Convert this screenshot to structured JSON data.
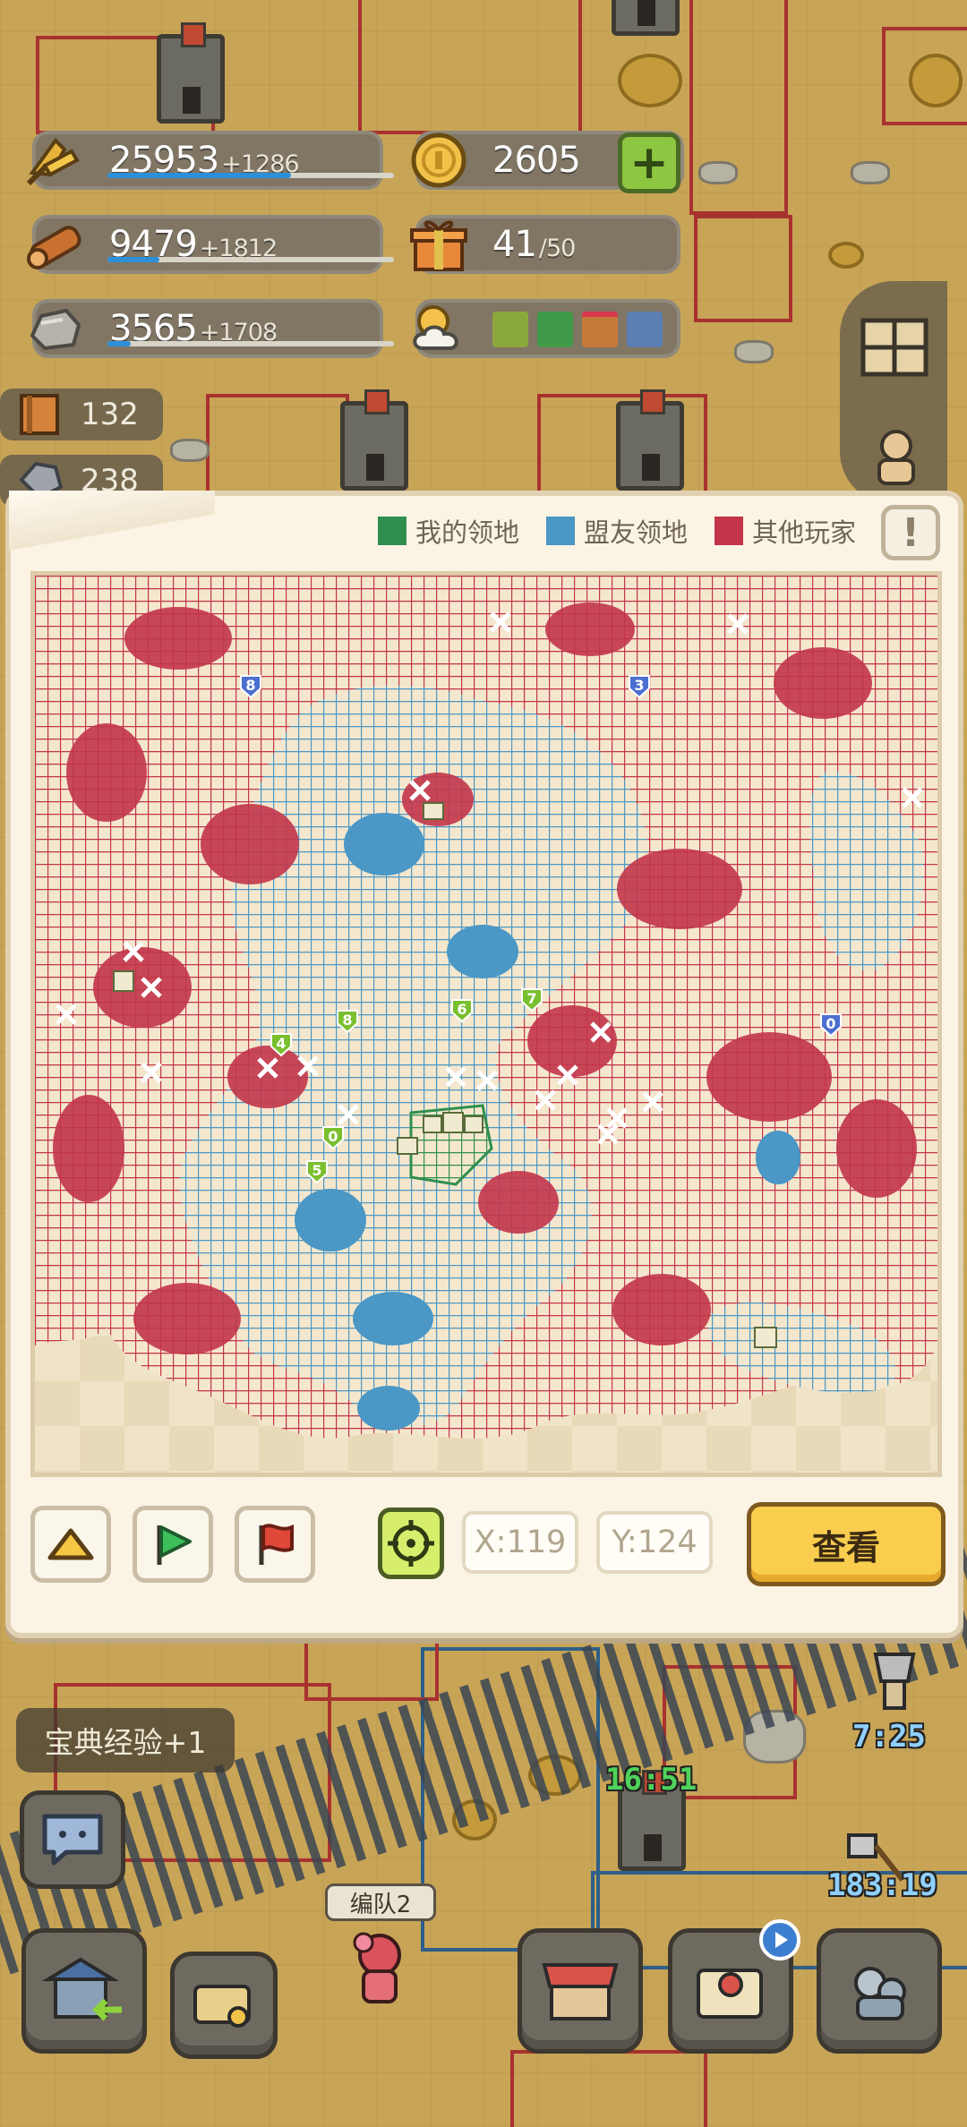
{
  "resources": [
    {
      "name": "food",
      "icon": "wheat-icon",
      "value": "25953",
      "increment": "+1286",
      "progress": 0.64
    },
    {
      "name": "wood",
      "icon": "log-icon",
      "value": "9479",
      "increment": "+1812",
      "progress": 0.18
    },
    {
      "name": "stone",
      "icon": "stone-icon",
      "value": "3565",
      "increment": "+1708",
      "progress": 0.08
    }
  ],
  "gold": {
    "icon": "gold-coin-icon",
    "value": "2605"
  },
  "gifts": {
    "icon": "gift-icon",
    "value": "41",
    "max": "/50"
  },
  "weather": {
    "icon": "weather-sun-cloud-icon",
    "slots": [
      "#8aa83c",
      "#3f9a4a",
      "#c67a39",
      "#5b7fb3"
    ]
  },
  "books": {
    "icon": "book-icon",
    "value": "132"
  },
  "ore": {
    "icon": "ore-icon",
    "value": "238"
  },
  "map_panel": {
    "legend": [
      {
        "label": "我的领地",
        "color": "#2f8f4e"
      },
      {
        "label": "盟友领地",
        "color": "#4b97c6"
      },
      {
        "label": "其他玩家",
        "color": "#c2354a"
      }
    ],
    "info_label": "!",
    "markers": [
      {
        "type": "shield",
        "label": "8"
      },
      {
        "type": "shield",
        "label": "3"
      },
      {
        "type": "shield",
        "label": "8"
      },
      {
        "type": "shield",
        "label": "6"
      },
      {
        "type": "shield",
        "label": "7"
      },
      {
        "type": "shield",
        "label": "0"
      },
      {
        "type": "shield",
        "label": "0"
      },
      {
        "type": "shield",
        "label": "5"
      },
      {
        "type": "shield",
        "label": "4"
      }
    ],
    "colors": {
      "background": "#efe2c5",
      "other": "#c2354a",
      "ally": "#4b97c6",
      "mine": "#2f8f4e"
    },
    "x_label": "X:",
    "x_value": "119",
    "y_label": "Y:",
    "y_value": "124",
    "view_label": "查看"
  },
  "toast": "宝典经验+1",
  "timers": [
    {
      "value": "7:25",
      "color": "#8fd0ff"
    },
    {
      "value": "16:51",
      "color": "#4fd35a"
    },
    {
      "value": "183:19",
      "color": "#8fd0ff"
    }
  ],
  "squad": "编队2"
}
